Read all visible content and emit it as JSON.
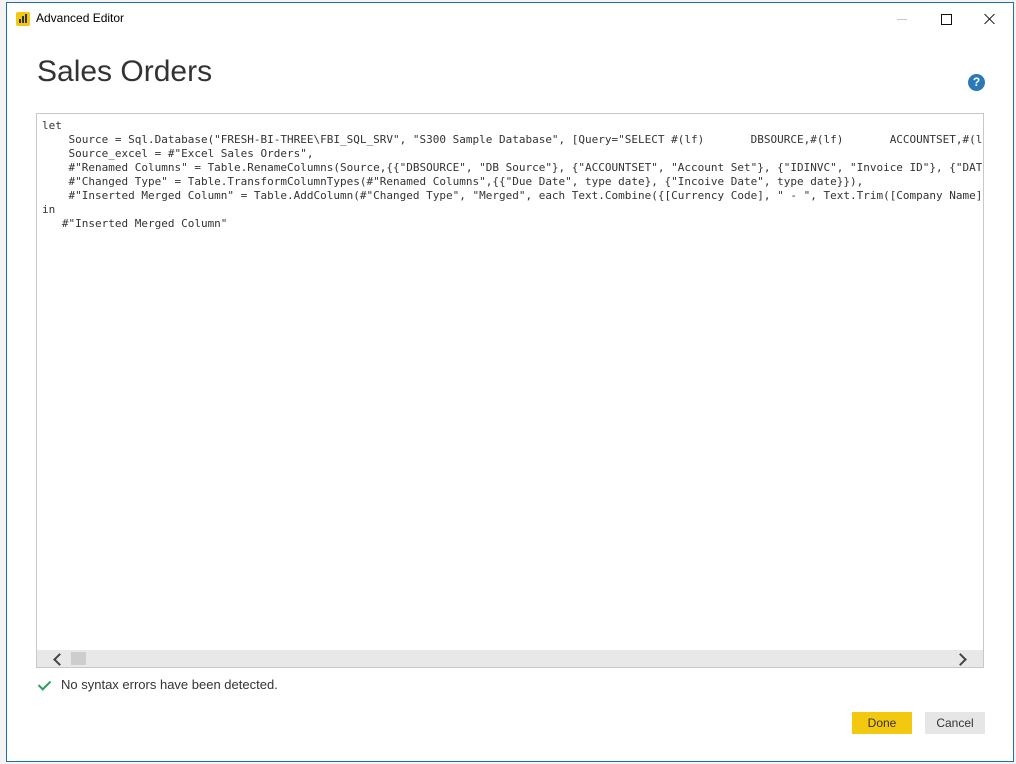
{
  "window": {
    "title": "Advanced Editor"
  },
  "query": {
    "name": "Sales Orders"
  },
  "editor": {
    "lines": [
      "let",
      "    Source = Sql.Database(\"FRESH-BI-THREE\\FBI_SQL_SRV\", \"S300 Sample Database\", [Query=\"SELECT #(lf)       DBSOURCE,#(lf)       ACCOUNTSET,#(lf",
      "    Source_excel = #\"Excel Sales Orders\",",
      "    #\"Renamed Columns\" = Table.RenameColumns(Source,{{\"DBSOURCE\", \"DB Source\"}, {\"ACCOUNTSET\", \"Account Set\"}, {\"IDINVC\", \"Invoice ID\"}, {\"DATE",
      "    #\"Changed Type\" = Table.TransformColumnTypes(#\"Renamed Columns\",{{\"Due Date\", type date}, {\"Incoive Date\", type date}}),",
      "    #\"Inserted Merged Column\" = Table.AddColumn(#\"Changed Type\", \"Merged\", each Text.Combine({[Currency Code], \" - \", Text.Trim([Company Name])",
      "in",
      "   #\"Inserted Merged Column\""
    ]
  },
  "status": {
    "message": "No syntax errors have been detected."
  },
  "buttons": {
    "done": "Done",
    "cancel": "Cancel"
  },
  "colors": {
    "accent": "#f2c811",
    "help": "#2a7ab8",
    "check": "#2e9e5b"
  },
  "icons": [
    "powerbi-app-icon",
    "minimize-icon",
    "maximize-icon",
    "close-icon",
    "help-icon",
    "chevron-left-icon",
    "chevron-right-icon",
    "check-icon"
  ]
}
